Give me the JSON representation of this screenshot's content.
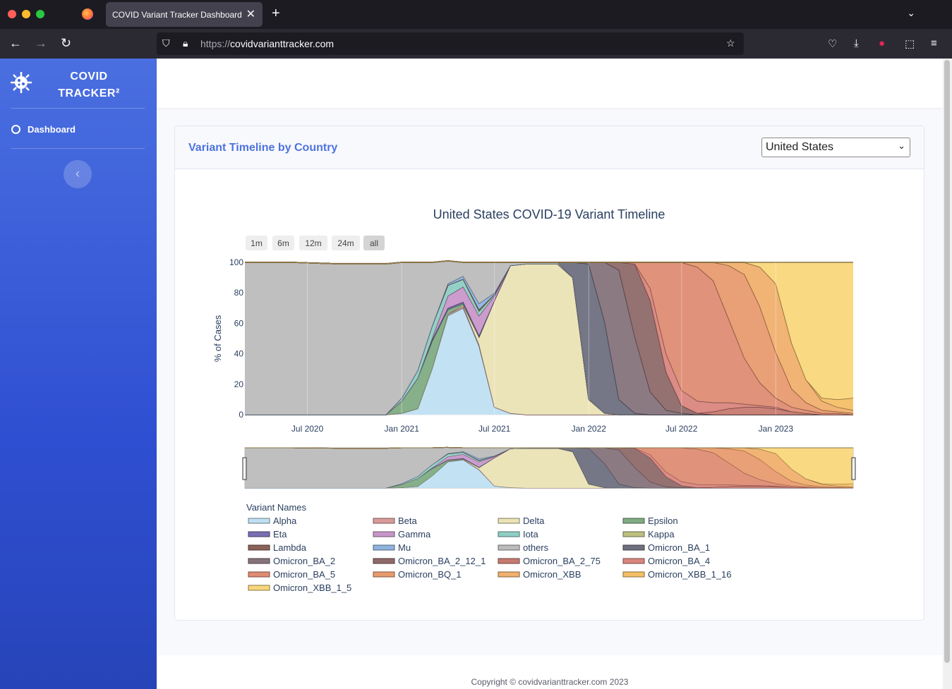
{
  "browser": {
    "tab_title": "COVID Variant Tracker Dashboard",
    "url_scheme": "https://",
    "url_host": "covidvarianttracker.com"
  },
  "sidebar": {
    "brand_line1": "COVID",
    "brand_line2": "TRACKER²",
    "items": [
      {
        "label": "Dashboard",
        "icon": "gauge-icon"
      }
    ]
  },
  "card": {
    "title": "Variant Timeline by Country",
    "country_selected": "United States"
  },
  "footer": {
    "copyright": "Copyright © covidvarianttracker.com 2023"
  },
  "chart_data": {
    "type": "area",
    "stacked": true,
    "title": "United States COVID-19 Variant Timeline",
    "ylabel": "% of Cases",
    "xlabel": "",
    "ylim": [
      0,
      100
    ],
    "yticks": [
      0,
      20,
      40,
      60,
      80,
      100
    ],
    "xticks": [
      "Jul 2020",
      "Jan 2021",
      "Jul 2021",
      "Jan 2022",
      "Jul 2022",
      "Jan 2023"
    ],
    "range_buttons": [
      "1m",
      "6m",
      "12m",
      "24m",
      "all"
    ],
    "active_range": "all",
    "legend_title": "Variant Names",
    "legend_placement": "bottom",
    "range_slider": true,
    "x": [
      "2020-03",
      "2020-06",
      "2020-09",
      "2020-12",
      "2021-01",
      "2021-02",
      "2021-03",
      "2021-04",
      "2021-05",
      "2021-06",
      "2021-07",
      "2021-08",
      "2021-09",
      "2021-10",
      "2021-11",
      "2021-12",
      "2022-01",
      "2022-02",
      "2022-03",
      "2022-04",
      "2022-05",
      "2022-06",
      "2022-07",
      "2022-08",
      "2022-09",
      "2022-10",
      "2022-11",
      "2022-12",
      "2023-01",
      "2023-02",
      "2023-03",
      "2023-04",
      "2023-05",
      "2023-06"
    ],
    "series": [
      {
        "name": "Alpha",
        "color": "#bfe0f2",
        "values": [
          0,
          0,
          0,
          0,
          1,
          4,
          30,
          65,
          70,
          45,
          5,
          1,
          0,
          0,
          0,
          0,
          0,
          0,
          0,
          0,
          0,
          0,
          0,
          0,
          0,
          0,
          0,
          0,
          0,
          0,
          0,
          0,
          0,
          0
        ]
      },
      {
        "name": "Beta",
        "color": "#d99a9a",
        "values": [
          0,
          0,
          0,
          0,
          0,
          0,
          0,
          1,
          1,
          1,
          0,
          0,
          0,
          0,
          0,
          0,
          0,
          0,
          0,
          0,
          0,
          0,
          0,
          0,
          0,
          0,
          0,
          0,
          0,
          0,
          0,
          0,
          0,
          0
        ]
      },
      {
        "name": "Delta",
        "color": "#ebe3b5",
        "values": [
          0,
          0,
          0,
          0,
          0,
          0,
          0,
          0,
          1,
          5,
          70,
          97,
          99,
          99,
          99,
          90,
          10,
          1,
          0,
          0,
          0,
          0,
          0,
          0,
          0,
          0,
          0,
          0,
          0,
          0,
          0,
          0,
          0,
          0
        ]
      },
      {
        "name": "Epsilon",
        "color": "#7fac84",
        "values": [
          0,
          0,
          0,
          0,
          8,
          20,
          18,
          3,
          1,
          0,
          0,
          0,
          0,
          0,
          0,
          0,
          0,
          0,
          0,
          0,
          0,
          0,
          0,
          0,
          0,
          0,
          0,
          0,
          0,
          0,
          0,
          0,
          0,
          0
        ]
      },
      {
        "name": "Eta",
        "color": "#7a6fb2",
        "values": [
          0,
          0,
          0,
          0,
          0,
          0,
          1,
          1,
          1,
          1,
          0,
          0,
          0,
          0,
          0,
          0,
          0,
          0,
          0,
          0,
          0,
          0,
          0,
          0,
          0,
          0,
          0,
          0,
          0,
          0,
          0,
          0,
          0,
          0
        ]
      },
      {
        "name": "Gamma",
        "color": "#c897c9",
        "values": [
          0,
          0,
          0,
          0,
          0,
          0,
          1,
          8,
          10,
          13,
          3,
          0,
          0,
          0,
          0,
          0,
          0,
          0,
          0,
          0,
          0,
          0,
          0,
          0,
          0,
          0,
          0,
          0,
          0,
          0,
          0,
          0,
          0,
          0
        ]
      },
      {
        "name": "Iota",
        "color": "#8fcec4",
        "values": [
          0,
          0,
          0,
          0,
          2,
          5,
          8,
          7,
          5,
          3,
          1,
          0,
          0,
          0,
          0,
          0,
          0,
          0,
          0,
          0,
          0,
          0,
          0,
          0,
          0,
          0,
          0,
          0,
          0,
          0,
          0,
          0,
          0,
          0
        ]
      },
      {
        "name": "Kappa",
        "color": "#bdbf7e",
        "values": [
          0,
          0,
          0,
          0,
          0,
          0,
          0,
          0,
          0,
          0,
          0,
          0,
          0,
          0,
          0,
          0,
          0,
          0,
          0,
          0,
          0,
          0,
          0,
          0,
          0,
          0,
          0,
          0,
          0,
          0,
          0,
          0,
          0,
          0
        ]
      },
      {
        "name": "Lambda",
        "color": "#8a6359",
        "values": [
          0,
          0,
          0,
          0,
          0,
          0,
          0,
          0,
          0,
          1,
          0,
          0,
          0,
          0,
          0,
          0,
          0,
          0,
          0,
          0,
          0,
          0,
          0,
          0,
          0,
          0,
          0,
          0,
          0,
          0,
          0,
          0,
          0,
          0
        ]
      },
      {
        "name": "Mu",
        "color": "#8fb4df",
        "values": [
          0,
          0,
          0,
          0,
          0,
          0,
          0,
          1,
          2,
          4,
          1,
          0,
          0,
          0,
          0,
          0,
          0,
          0,
          0,
          0,
          0,
          0,
          0,
          0,
          0,
          0,
          0,
          0,
          0,
          0,
          0,
          0,
          0,
          0
        ]
      },
      {
        "name": "others",
        "color": "#bcbcbc",
        "values": [
          100,
          100,
          99,
          99,
          89,
          71,
          42,
          15,
          9,
          27,
          20,
          2,
          1,
          1,
          1,
          0,
          0,
          0,
          0,
          0,
          0,
          0,
          0,
          0,
          0,
          0,
          0,
          0,
          0,
          0,
          0,
          0,
          0,
          0
        ]
      },
      {
        "name": "Omicron_BA_1",
        "color": "#6e7080",
        "values": [
          0,
          0,
          0,
          0,
          0,
          0,
          0,
          0,
          0,
          0,
          0,
          0,
          0,
          0,
          0,
          10,
          89,
          60,
          10,
          1,
          0,
          0,
          0,
          0,
          0,
          0,
          0,
          0,
          0,
          0,
          0,
          0,
          0,
          0
        ]
      },
      {
        "name": "Omicron_BA_2",
        "color": "#86737c",
        "values": [
          0,
          0,
          0,
          0,
          0,
          0,
          0,
          0,
          0,
          0,
          0,
          0,
          0,
          0,
          0,
          0,
          1,
          39,
          85,
          50,
          15,
          3,
          1,
          0,
          0,
          0,
          0,
          0,
          0,
          0,
          0,
          0,
          0,
          0
        ]
      },
      {
        "name": "Omicron_BA_2_12_1",
        "color": "#8f6a6a",
        "values": [
          0,
          0,
          0,
          0,
          0,
          0,
          0,
          0,
          0,
          0,
          0,
          0,
          0,
          0,
          0,
          0,
          0,
          0,
          5,
          48,
          60,
          25,
          5,
          1,
          0,
          0,
          0,
          0,
          0,
          0,
          0,
          0,
          0,
          0
        ]
      },
      {
        "name": "Omicron_BA_2_75",
        "color": "#c77a70",
        "values": [
          0,
          0,
          0,
          0,
          0,
          0,
          0,
          0,
          0,
          0,
          0,
          0,
          0,
          0,
          0,
          0,
          0,
          0,
          0,
          0,
          0,
          0,
          0,
          0,
          2,
          4,
          5,
          5,
          4,
          2,
          1,
          0,
          0,
          0
        ]
      },
      {
        "name": "Omicron_BA_4",
        "color": "#d9867e",
        "values": [
          0,
          0,
          0,
          0,
          0,
          0,
          0,
          0,
          0,
          0,
          0,
          0,
          0,
          0,
          0,
          0,
          0,
          0,
          0,
          0,
          8,
          12,
          10,
          8,
          6,
          4,
          2,
          1,
          1,
          0,
          0,
          0,
          0,
          0
        ]
      },
      {
        "name": "Omicron_BA_5",
        "color": "#de8c74",
        "values": [
          0,
          0,
          0,
          0,
          0,
          0,
          0,
          0,
          0,
          0,
          0,
          0,
          0,
          0,
          0,
          0,
          0,
          0,
          0,
          1,
          17,
          60,
          84,
          88,
          80,
          55,
          30,
          15,
          6,
          3,
          2,
          1,
          1,
          0
        ]
      },
      {
        "name": "Omicron_BQ_1",
        "color": "#e89b6f",
        "values": [
          0,
          0,
          0,
          0,
          0,
          0,
          0,
          0,
          0,
          0,
          0,
          0,
          0,
          0,
          0,
          0,
          0,
          0,
          0,
          0,
          0,
          0,
          0,
          3,
          12,
          35,
          55,
          50,
          30,
          12,
          5,
          2,
          1,
          1
        ]
      },
      {
        "name": "Omicron_XBB",
        "color": "#f0b06e",
        "values": [
          0,
          0,
          0,
          0,
          0,
          0,
          0,
          0,
          0,
          0,
          0,
          0,
          0,
          0,
          0,
          0,
          0,
          0,
          0,
          0,
          0,
          0,
          0,
          0,
          0,
          2,
          8,
          26,
          45,
          30,
          15,
          6,
          3,
          2
        ]
      },
      {
        "name": "Omicron_XBB_1_16",
        "color": "#f4c067",
        "values": [
          0,
          0,
          0,
          0,
          0,
          0,
          0,
          0,
          0,
          0,
          0,
          0,
          0,
          0,
          0,
          0,
          0,
          0,
          0,
          0,
          0,
          0,
          0,
          0,
          0,
          0,
          0,
          0,
          0,
          0,
          0,
          2,
          5,
          8
        ]
      },
      {
        "name": "Omicron_XBB_1_5",
        "color": "#fad77c",
        "values": [
          0,
          0,
          0,
          0,
          0,
          0,
          0,
          0,
          0,
          0,
          0,
          0,
          0,
          0,
          0,
          0,
          0,
          0,
          0,
          0,
          0,
          0,
          0,
          0,
          0,
          0,
          0,
          3,
          14,
          53,
          77,
          89,
          90,
          89
        ]
      }
    ]
  }
}
